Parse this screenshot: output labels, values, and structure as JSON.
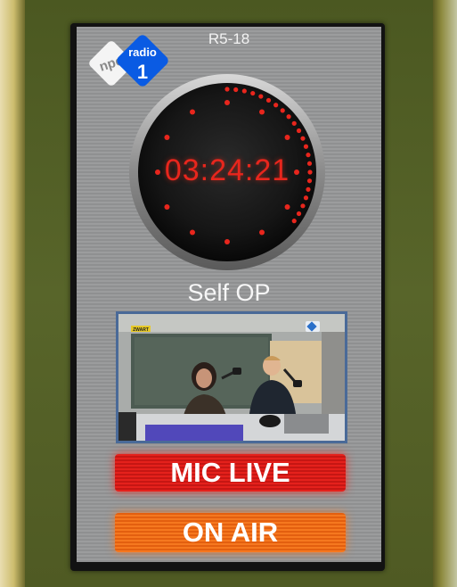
{
  "screen": {
    "studio_label": "R5-18",
    "logo": {
      "npo_text": "npo",
      "radio_text": "radio",
      "channel_text": "1"
    },
    "clock": {
      "time": "03:24:21",
      "seconds_elapsed": 21
    },
    "operator_mode": "Self OP",
    "video_feed": {
      "brand_sign": "ZWART"
    },
    "status_mic": "MIC LIVE",
    "status_air": "ON AIR"
  },
  "colors": {
    "clock_red": "#e8261d",
    "mic_live_red": "#e5211c",
    "on_air_orange": "#f6781f",
    "npo_blue": "#0a5be3"
  }
}
